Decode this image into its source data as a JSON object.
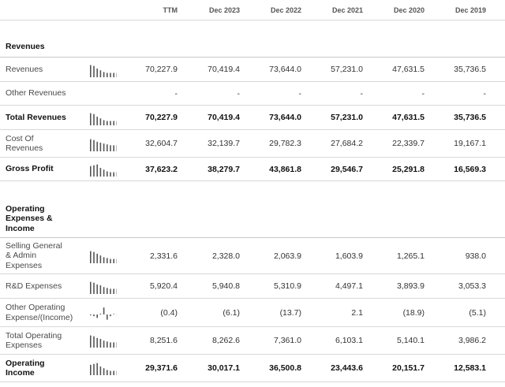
{
  "columns": [
    "TTM",
    "Dec 2023",
    "Dec 2022",
    "Dec 2021",
    "Dec 2020",
    "Dec 2019"
  ],
  "sections": {
    "revenues": "Revenues",
    "operating": "Operating Expenses & Income"
  },
  "rows": [
    {
      "label": "Revenues",
      "values": [
        "70,227.9",
        "70,419.4",
        "73,644.0",
        "57,231.0",
        "47,631.5",
        "35,736.5"
      ],
      "spark": [
        7,
        6.5,
        5,
        4,
        3,
        2.5,
        2.5,
        2.5,
        2.5
      ]
    },
    {
      "label": "Other Revenues",
      "values": [
        "-",
        "-",
        "-",
        "-",
        "-",
        "-"
      ],
      "spark": []
    },
    {
      "label": "Total Revenues",
      "values": [
        "70,227.9",
        "70,419.4",
        "73,644.0",
        "57,231.0",
        "47,631.5",
        "35,736.5"
      ],
      "spark": [
        7,
        6.5,
        5,
        4,
        3,
        2.5,
        2.5,
        2.5,
        2.5
      ]
    },
    {
      "label": "Cost Of Revenues",
      "values": [
        "32,604.7",
        "32,139.7",
        "29,782.3",
        "27,684.2",
        "22,339.7",
        "19,167.1"
      ],
      "spark": [
        7,
        6.5,
        5.5,
        5,
        4.5,
        4,
        3.5,
        3.5,
        3.5
      ]
    },
    {
      "label": "Gross Profit",
      "values": [
        "37,623.2",
        "38,279.7",
        "43,861.8",
        "29,546.7",
        "25,291.8",
        "16,569.3"
      ],
      "spark": [
        6,
        6.5,
        7,
        5,
        4,
        3,
        2.5,
        2.5,
        2.5
      ]
    },
    {
      "label": "Selling General & Admin Expenses",
      "values": [
        "2,331.6",
        "2,328.0",
        "2,063.9",
        "1,603.9",
        "1,265.1",
        "938.0"
      ],
      "spark": [
        7,
        6.5,
        5.5,
        4.5,
        3.5,
        3,
        2.5,
        2.5,
        2.5
      ]
    },
    {
      "label": "R&D Expenses",
      "values": [
        "5,920.4",
        "5,940.8",
        "5,310.9",
        "4,497.1",
        "3,893.9",
        "3,053.3"
      ],
      "spark": [
        7,
        6.5,
        5.5,
        5,
        4,
        3.5,
        3,
        3,
        3
      ]
    },
    {
      "label": "Other Operating Expense/(Income)",
      "values": [
        "(0.4)",
        "(6.1)",
        "(13.7)",
        "2.1",
        "(18.9)",
        "(5.1)"
      ],
      "spark": [
        -0.5,
        -1,
        -2,
        0.5,
        4,
        -3,
        -1,
        0.3,
        -0.3
      ]
    },
    {
      "label": "Total Operating Expenses",
      "values": [
        "8,251.6",
        "8,262.6",
        "7,361.0",
        "6,103.1",
        "5,140.1",
        "3,986.2"
      ],
      "spark": [
        7,
        6.5,
        5.5,
        5,
        4,
        3.5,
        3,
        3,
        3
      ]
    },
    {
      "label": "Operating Income",
      "values": [
        "29,371.6",
        "30,017.1",
        "36,500.8",
        "23,443.6",
        "20,151.7",
        "12,583.1"
      ],
      "spark": [
        6,
        6.5,
        7,
        5,
        4,
        3,
        2.5,
        2.5,
        2.5
      ]
    }
  ]
}
